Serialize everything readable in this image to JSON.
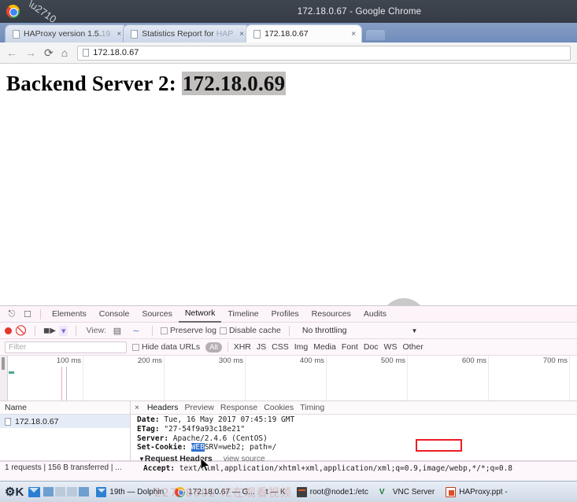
{
  "window": {
    "title": "172.18.0.67 - Google Chrome",
    "pin_icon": "pin-icon",
    "logo_icon": "chrome-logo-icon"
  },
  "tabs": [
    {
      "label": "HAProxy version 1.5.",
      "label_dim": "19",
      "close": "×",
      "active": false
    },
    {
      "label": "Statistics Report for ",
      "label_dim": "HAP",
      "close": "×",
      "active": false
    },
    {
      "label": "172.18.0.67",
      "label_dim": "",
      "close": "×",
      "active": true
    }
  ],
  "toolbar": {
    "back": "←",
    "forward": "→",
    "reload": "⟳",
    "home": "⌂",
    "url": "172.18.0.67"
  },
  "page": {
    "heading_prefix": "Backend Server 2: ",
    "heading_selected": "172.18.0.69",
    "recording_overlay": "paused-recording-indicator"
  },
  "devtools": {
    "tabs": [
      "Elements",
      "Console",
      "Sources",
      "Network",
      "Timeline",
      "Profiles",
      "Resources",
      "Audits"
    ],
    "active_tab": "Network",
    "inspect_icon": "inspect-element-icon",
    "device_icon": "device-toolbar-icon",
    "toolbar": {
      "record_icon": "record-button",
      "clear_icon": "clear-button",
      "capture_icon": "capture-screenshots-icon",
      "filter_icon": "filter-icon",
      "view_label": "View:",
      "view_list_icon": "list-view-icon",
      "view_waterfall_icon": "waterfall-view-icon",
      "preserve_log": "Preserve log",
      "disable_cache": "Disable cache",
      "throttling": "No throttling",
      "throttling_caret": "▼"
    },
    "filterbar": {
      "filter_placeholder": "Filter",
      "hide_data_urls": "Hide data URLs",
      "all_pill": "All",
      "types": [
        "XHR",
        "JS",
        "CSS",
        "Img",
        "Media",
        "Font",
        "Doc",
        "WS",
        "Other"
      ]
    },
    "timeline_ticks": [
      "100 ms",
      "200 ms",
      "300 ms",
      "400 ms",
      "500 ms",
      "600 ms",
      "700 ms"
    ],
    "requests": {
      "column_header": "Name",
      "rows": [
        {
          "name": "172.18.0.67"
        }
      ]
    },
    "details": {
      "close": "×",
      "tabs": [
        "Headers",
        "Preview",
        "Response",
        "Cookies",
        "Timing"
      ],
      "active_tab": "Headers",
      "response_headers": [
        {
          "name": "Date:",
          "value": " Tue, 16 May 2017 07:45:19 GMT"
        },
        {
          "name": "ETag:",
          "value": " \"27-54f9a93c18e21\""
        },
        {
          "name": "Server:",
          "value": " Apache/2.4.6 (CentOS)"
        }
      ],
      "set_cookie": {
        "name": "Set-Cookie:",
        "selected_part": "WEB",
        "rest": "SRV=web2; path=/"
      },
      "request_headers_title": "Request Headers",
      "request_headers_twisty": "▼",
      "view_source": "view source",
      "accept_header_name": "Accept:",
      "accept_header_value": " text/html,application/xhtml+xml,application/xml;q=0.9,image/webp,*/*;q=0.8",
      "highlight_box_color": "#ec1c24"
    },
    "status": "1 requests | 156 B transferred | ..."
  },
  "taskbar": {
    "kmenu_icon": "k-menu-icon",
    "mail_icon": "mail-icon",
    "pager_icon": "pager-icon",
    "items": [
      {
        "icon": "folder",
        "label": "19th — Dolphin"
      },
      {
        "icon": "chrome",
        "label": "172.18.0.67 — G..."
      },
      {
        "icon": "none",
        "label": "t — K"
      },
      {
        "icon": "term",
        "label": "root@node1:/etc"
      },
      {
        "icon": "vnc",
        "label": "VNC Server"
      },
      {
        "icon": "ppt",
        "label": "HAProxy.ppt -"
      }
    ]
  },
  "watermarks": {
    "main": "22768692 IE在观看视频",
    "secondary": "————————"
  }
}
